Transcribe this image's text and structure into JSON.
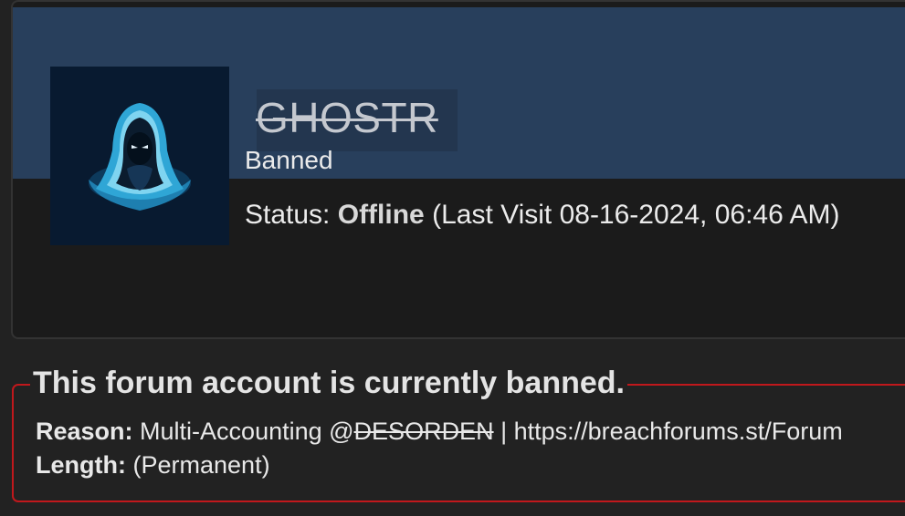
{
  "profile": {
    "username": "GHOSTR",
    "usertitle": "Banned",
    "status_label": "Status:",
    "status_value": "Offline",
    "last_visit": "(Last Visit 08-16-2024, 06:46 AM)",
    "avatar_icon": "hooded-figure-icon"
  },
  "ban": {
    "heading": "This forum account is currently banned.",
    "reason_label": "Reason:",
    "reason_prefix": "Multi-Accounting @",
    "reason_struck": "DESORDEN",
    "reason_suffix": " | https://breachforums.st/Forum",
    "length_label": "Length:",
    "length_value": "(Permanent)"
  },
  "colors": {
    "banner": "#283f5c",
    "ban_border": "#c0181c",
    "background": "#222222"
  }
}
